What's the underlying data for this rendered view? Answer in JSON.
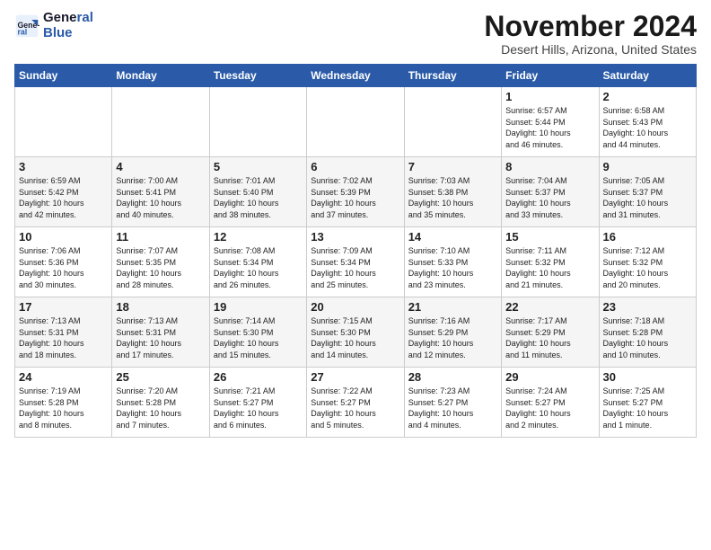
{
  "logo": {
    "line1": "General",
    "line2": "Blue"
  },
  "title": "November 2024",
  "location": "Desert Hills, Arizona, United States",
  "days_header": [
    "Sunday",
    "Monday",
    "Tuesday",
    "Wednesday",
    "Thursday",
    "Friday",
    "Saturday"
  ],
  "weeks": [
    [
      {
        "day": "",
        "info": ""
      },
      {
        "day": "",
        "info": ""
      },
      {
        "day": "",
        "info": ""
      },
      {
        "day": "",
        "info": ""
      },
      {
        "day": "",
        "info": ""
      },
      {
        "day": "1",
        "info": "Sunrise: 6:57 AM\nSunset: 5:44 PM\nDaylight: 10 hours\nand 46 minutes."
      },
      {
        "day": "2",
        "info": "Sunrise: 6:58 AM\nSunset: 5:43 PM\nDaylight: 10 hours\nand 44 minutes."
      }
    ],
    [
      {
        "day": "3",
        "info": "Sunrise: 6:59 AM\nSunset: 5:42 PM\nDaylight: 10 hours\nand 42 minutes."
      },
      {
        "day": "4",
        "info": "Sunrise: 7:00 AM\nSunset: 5:41 PM\nDaylight: 10 hours\nand 40 minutes."
      },
      {
        "day": "5",
        "info": "Sunrise: 7:01 AM\nSunset: 5:40 PM\nDaylight: 10 hours\nand 38 minutes."
      },
      {
        "day": "6",
        "info": "Sunrise: 7:02 AM\nSunset: 5:39 PM\nDaylight: 10 hours\nand 37 minutes."
      },
      {
        "day": "7",
        "info": "Sunrise: 7:03 AM\nSunset: 5:38 PM\nDaylight: 10 hours\nand 35 minutes."
      },
      {
        "day": "8",
        "info": "Sunrise: 7:04 AM\nSunset: 5:37 PM\nDaylight: 10 hours\nand 33 minutes."
      },
      {
        "day": "9",
        "info": "Sunrise: 7:05 AM\nSunset: 5:37 PM\nDaylight: 10 hours\nand 31 minutes."
      }
    ],
    [
      {
        "day": "10",
        "info": "Sunrise: 7:06 AM\nSunset: 5:36 PM\nDaylight: 10 hours\nand 30 minutes."
      },
      {
        "day": "11",
        "info": "Sunrise: 7:07 AM\nSunset: 5:35 PM\nDaylight: 10 hours\nand 28 minutes."
      },
      {
        "day": "12",
        "info": "Sunrise: 7:08 AM\nSunset: 5:34 PM\nDaylight: 10 hours\nand 26 minutes."
      },
      {
        "day": "13",
        "info": "Sunrise: 7:09 AM\nSunset: 5:34 PM\nDaylight: 10 hours\nand 25 minutes."
      },
      {
        "day": "14",
        "info": "Sunrise: 7:10 AM\nSunset: 5:33 PM\nDaylight: 10 hours\nand 23 minutes."
      },
      {
        "day": "15",
        "info": "Sunrise: 7:11 AM\nSunset: 5:32 PM\nDaylight: 10 hours\nand 21 minutes."
      },
      {
        "day": "16",
        "info": "Sunrise: 7:12 AM\nSunset: 5:32 PM\nDaylight: 10 hours\nand 20 minutes."
      }
    ],
    [
      {
        "day": "17",
        "info": "Sunrise: 7:13 AM\nSunset: 5:31 PM\nDaylight: 10 hours\nand 18 minutes."
      },
      {
        "day": "18",
        "info": "Sunrise: 7:13 AM\nSunset: 5:31 PM\nDaylight: 10 hours\nand 17 minutes."
      },
      {
        "day": "19",
        "info": "Sunrise: 7:14 AM\nSunset: 5:30 PM\nDaylight: 10 hours\nand 15 minutes."
      },
      {
        "day": "20",
        "info": "Sunrise: 7:15 AM\nSunset: 5:30 PM\nDaylight: 10 hours\nand 14 minutes."
      },
      {
        "day": "21",
        "info": "Sunrise: 7:16 AM\nSunset: 5:29 PM\nDaylight: 10 hours\nand 12 minutes."
      },
      {
        "day": "22",
        "info": "Sunrise: 7:17 AM\nSunset: 5:29 PM\nDaylight: 10 hours\nand 11 minutes."
      },
      {
        "day": "23",
        "info": "Sunrise: 7:18 AM\nSunset: 5:28 PM\nDaylight: 10 hours\nand 10 minutes."
      }
    ],
    [
      {
        "day": "24",
        "info": "Sunrise: 7:19 AM\nSunset: 5:28 PM\nDaylight: 10 hours\nand 8 minutes."
      },
      {
        "day": "25",
        "info": "Sunrise: 7:20 AM\nSunset: 5:28 PM\nDaylight: 10 hours\nand 7 minutes."
      },
      {
        "day": "26",
        "info": "Sunrise: 7:21 AM\nSunset: 5:27 PM\nDaylight: 10 hours\nand 6 minutes."
      },
      {
        "day": "27",
        "info": "Sunrise: 7:22 AM\nSunset: 5:27 PM\nDaylight: 10 hours\nand 5 minutes."
      },
      {
        "day": "28",
        "info": "Sunrise: 7:23 AM\nSunset: 5:27 PM\nDaylight: 10 hours\nand 4 minutes."
      },
      {
        "day": "29",
        "info": "Sunrise: 7:24 AM\nSunset: 5:27 PM\nDaylight: 10 hours\nand 2 minutes."
      },
      {
        "day": "30",
        "info": "Sunrise: 7:25 AM\nSunset: 5:27 PM\nDaylight: 10 hours\nand 1 minute."
      }
    ]
  ]
}
